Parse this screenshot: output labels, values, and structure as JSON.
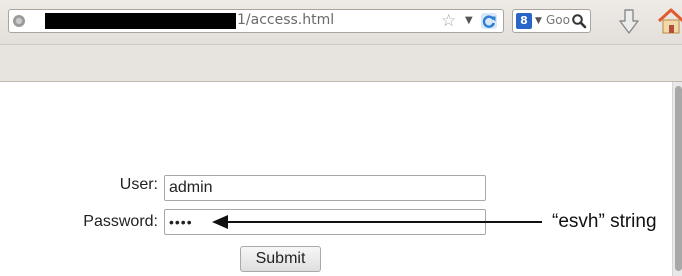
{
  "browser": {
    "url_visible_suffix": "1/access.html",
    "search_placeholder": "Goo",
    "search_engine_icon": "google-icon",
    "icons": [
      "globe-icon",
      "star-icon",
      "dropmark-icon",
      "reload-icon",
      "magnifier-icon",
      "download-icon",
      "home-icon"
    ],
    "colors": {
      "reload": "#2a7fd4",
      "home": "#e05b2e",
      "download": "#8a8a8a"
    }
  },
  "form": {
    "user_label": "User:",
    "user_value": "admin",
    "password_label": "Password:",
    "password_masked": "••••",
    "submit_label": "Submit"
  },
  "annotation": {
    "text": "“esvh” string"
  }
}
